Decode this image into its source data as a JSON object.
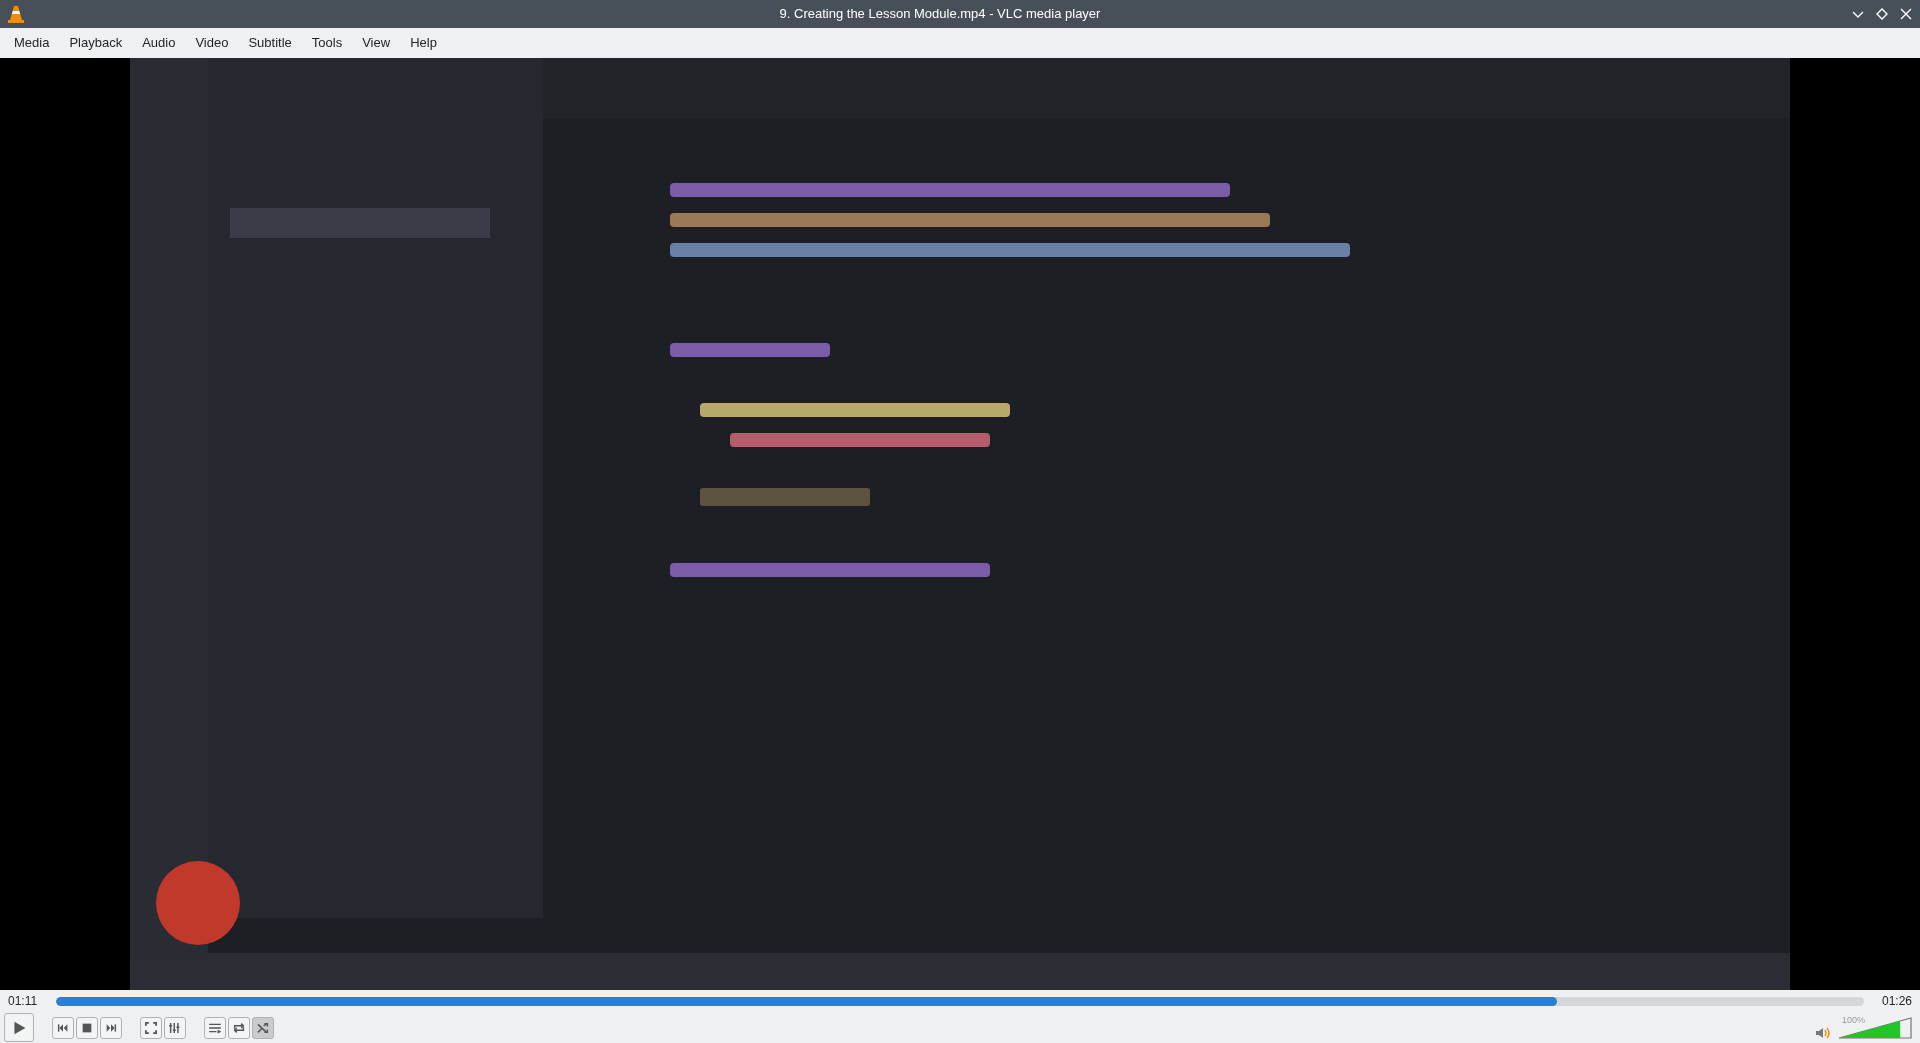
{
  "window": {
    "title": "9. Creating the Lesson Module.mp4 - VLC media player"
  },
  "menu": [
    "Media",
    "Playback",
    "Audio",
    "Video",
    "Subtitle",
    "Tools",
    "View",
    "Help"
  ],
  "seek": {
    "elapsed": "01:11",
    "total": "01:26",
    "level": 0.83
  },
  "controls": [
    {
      "kind": "play",
      "pressed": false
    },
    {
      "kind": "gap"
    },
    {
      "kind": "previous",
      "pressed": false
    },
    {
      "kind": "stop",
      "pressed": false
    },
    {
      "kind": "next",
      "pressed": false
    },
    {
      "kind": "gap"
    },
    {
      "kind": "fullscreen",
      "pressed": false
    },
    {
      "kind": "equalizer",
      "pressed": false
    },
    {
      "kind": "gap"
    },
    {
      "kind": "playlist",
      "pressed": false
    },
    {
      "kind": "loop",
      "pressed": false
    },
    {
      "kind": "shuffle",
      "pressed": true
    }
  ],
  "volume": {
    "reading": "100%",
    "level": 0.85
  }
}
